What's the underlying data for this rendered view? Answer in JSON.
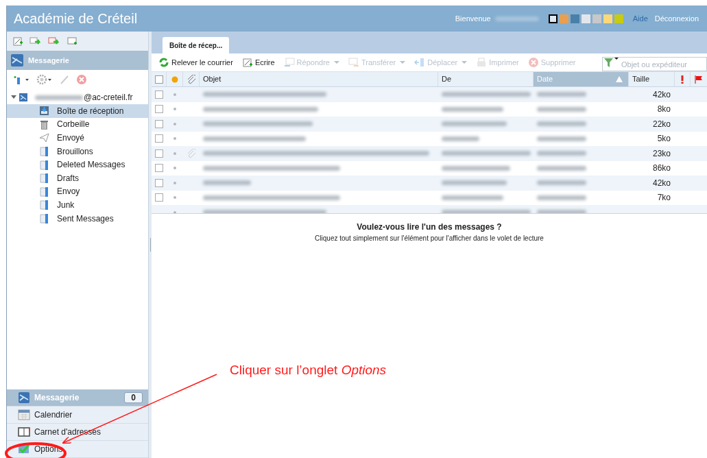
{
  "header": {
    "title": "Académie de Créteil",
    "welcome": "Bienvenue",
    "links": [
      "Aide",
      "Déconnexion"
    ],
    "theme_swatches": [
      {
        "color": "#dfe8f0",
        "selected": true
      },
      {
        "color": "#e8a050",
        "selected": false
      },
      {
        "color": "#4a7fa8",
        "selected": false
      },
      {
        "color": "#e2e6ec",
        "selected": false
      },
      {
        "color": "#c8c8c8",
        "selected": false
      },
      {
        "color": "#fcd878",
        "selected": false
      },
      {
        "color": "#c8cc10",
        "selected": false
      }
    ]
  },
  "sidebar": {
    "section_title": "Messagerie",
    "account": {
      "address": "@ac-creteil.fr",
      "expanded": true
    },
    "folders": [
      {
        "label": "Boîte de réception",
        "kind": "inbox",
        "selected": true
      },
      {
        "label": "Corbeille",
        "kind": "trash",
        "selected": false
      },
      {
        "label": "Envoyé",
        "kind": "sent",
        "selected": false
      },
      {
        "label": "Brouillons",
        "kind": "drafts",
        "selected": false
      },
      {
        "label": "Deleted Messages",
        "kind": "folder",
        "selected": false
      },
      {
        "label": "Drafts",
        "kind": "folder",
        "selected": false
      },
      {
        "label": "Envoy",
        "kind": "folder",
        "selected": false
      },
      {
        "label": "Junk",
        "kind": "folder",
        "selected": false
      },
      {
        "label": "Sent Messages",
        "kind": "folder",
        "selected": false
      }
    ],
    "bottom_nav": [
      {
        "label": "Messagerie",
        "count": "0",
        "kind": "mail",
        "selected": true
      },
      {
        "label": "Calendrier",
        "kind": "calendar",
        "selected": false
      },
      {
        "label": "Carnet d'adresses",
        "kind": "contacts",
        "selected": false
      },
      {
        "label": "Options",
        "kind": "options",
        "selected": false
      }
    ]
  },
  "main": {
    "tabs": [
      {
        "label": "Boîte de récep...",
        "selected": true
      }
    ],
    "toolbar": [
      {
        "label": "Relever le courrier",
        "kind": "refresh",
        "disabled": false,
        "dropdown": false
      },
      {
        "label": "Ecrire",
        "kind": "compose",
        "disabled": false,
        "dropdown": false
      },
      {
        "label": "Répondre",
        "kind": "reply",
        "disabled": true,
        "dropdown": true
      },
      {
        "label": "Transférer",
        "kind": "forward",
        "disabled": true,
        "dropdown": true
      },
      {
        "label": "Déplacer",
        "kind": "move",
        "disabled": true,
        "dropdown": true
      },
      {
        "label": "Imprimer",
        "kind": "print",
        "disabled": true,
        "dropdown": false
      },
      {
        "label": "Supprimer",
        "kind": "delete",
        "disabled": true,
        "dropdown": false
      }
    ],
    "search": {
      "placeholder": "Objet ou expéditeur"
    },
    "select_all": {
      "checked": false
    },
    "columns": [
      {
        "label": "Objet",
        "sorted": false
      },
      {
        "label": "De",
        "sorted": false
      },
      {
        "label": "Date",
        "sorted": true
      },
      {
        "label": "Taille",
        "sorted": false
      }
    ],
    "rows": [
      {
        "size": "42ko",
        "attachment": false,
        "checked": false
      },
      {
        "size": "8ko",
        "attachment": false,
        "checked": false
      },
      {
        "size": "22ko",
        "attachment": false,
        "checked": false
      },
      {
        "size": "5ko",
        "attachment": false,
        "checked": false
      },
      {
        "size": "23ko",
        "attachment": true,
        "checked": false
      },
      {
        "size": "86ko",
        "attachment": false,
        "checked": false
      },
      {
        "size": "42ko",
        "attachment": false,
        "checked": false
      },
      {
        "size": "7ko",
        "attachment": false,
        "checked": false
      }
    ],
    "reading_pane": {
      "title": "Voulez-vous lire l'un des messages ?",
      "hint": "Cliquez tout simplement sur l'élément pour l'afficher dans le volet de lecture"
    }
  },
  "annotation": {
    "text": "Cliquer sur l’onglet *Options*"
  }
}
